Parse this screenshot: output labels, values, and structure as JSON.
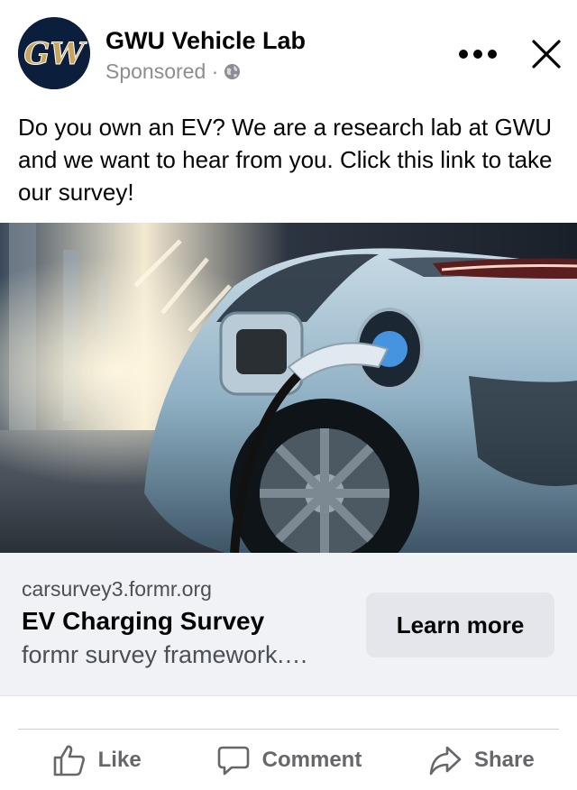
{
  "header": {
    "page_name": "GWU Vehicle Lab",
    "sponsored_label": "Sponsored ·",
    "avatar_monogram": "GW"
  },
  "post": {
    "text": "Do you own an EV? We are a research lab at GWU and we want to hear from you. Click this link to take our survey!"
  },
  "link_preview": {
    "domain": "carsurvey3.formr.org",
    "title": "EV Charging Survey",
    "description": "formr survey framework.…",
    "cta_label": "Learn more"
  },
  "actions": [
    {
      "label": "Like",
      "icon": "thumbs-up-icon"
    },
    {
      "label": "Comment",
      "icon": "comment-icon"
    },
    {
      "label": "Share",
      "icon": "share-icon"
    }
  ],
  "colors": {
    "avatar_bg": "#0b1f3d",
    "avatar_gold": "#c8a45c",
    "secondary_text": "#65676b",
    "card_bg": "#f0f2f5",
    "button_bg": "#e4e6eb"
  }
}
